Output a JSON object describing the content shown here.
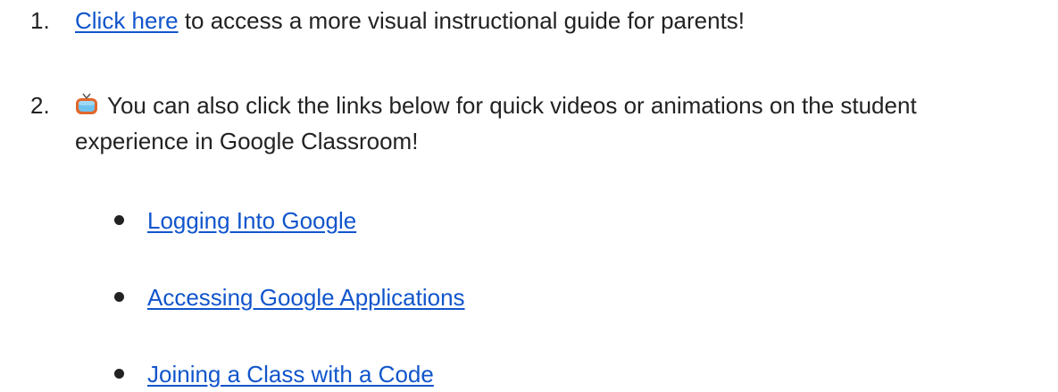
{
  "items": [
    {
      "number": "1.",
      "link_text": "Click here",
      "rest_text": " to access a more visual instructional guide for parents!"
    },
    {
      "number": "2.",
      "icon": "television-icon",
      "line1": "You can also click the links below for quick videos or animations on the student",
      "line2": "experience in Google Classroom!"
    }
  ],
  "links": [
    {
      "label": "Logging Into Google"
    },
    {
      "label": "Accessing Google Applications"
    },
    {
      "label": "Joining a Class with a Code"
    }
  ],
  "colors": {
    "link": "#1155cc",
    "text": "#222222"
  }
}
